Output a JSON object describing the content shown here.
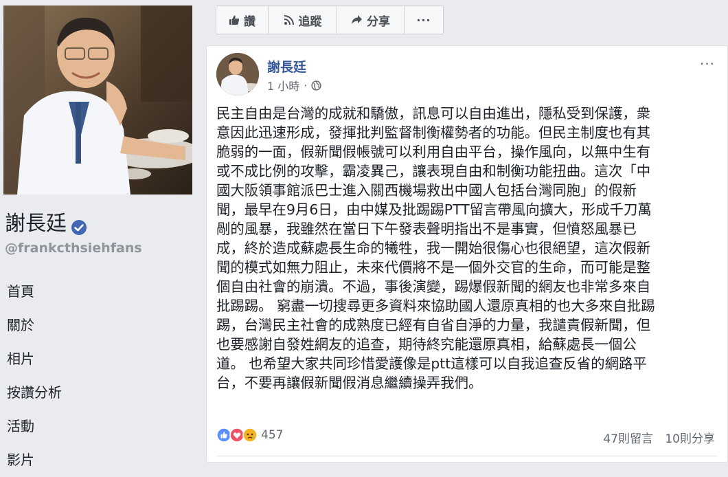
{
  "profile": {
    "name": "謝長廷",
    "handle": "@frankcthsiehfans",
    "verified": true
  },
  "nav": {
    "items": [
      {
        "label": "首頁"
      },
      {
        "label": "關於"
      },
      {
        "label": "相片"
      },
      {
        "label": "按讚分析"
      },
      {
        "label": "活動"
      },
      {
        "label": "影片"
      }
    ]
  },
  "actions": {
    "like_label": "讚",
    "follow_label": "追蹤",
    "share_label": "分享",
    "more_label": "···"
  },
  "post": {
    "author": "謝長廷",
    "time": "1 小時",
    "options_label": "···",
    "body": "民主自由是台灣的成就和驕傲，訊息可以自由進出，隱私受到保護，衆\n意因此迅速形成，發揮批判監督制衡權勢者的功能。但民主制度也有其\n脆弱的一面，假新聞假帳號可以利用自由平台，操作風向，以無中生有\n或不成比例的攻擊，霸凌異己，讓表現自由和制衡功能扭曲。這次「中\n國大阪領事館派巴士進入關西機場救出中國人包括台灣同胞」的假新\n聞，最早在9月6日，由中媒及批踢踢PTT留言帶風向擴大，形成千刀萬\n剮的風暴，我雖然在當日下午發表聲明指出不是事實，但憤怒風暴已\n成，終於造成蘇處長生命的犧牲，我一開始很傷心也很絕望，這次假新\n聞的模式如無力阻止，未來代價將不是一個外交官的生命，而可能是整\n個自由社會的崩潰。不過，事後演變，踢爆假新聞的網友也非常多來自\n批踢踢。 窮盡一切搜尋更多資料來協助國人還原真相的也大多來自批踢\n踢，台灣民主社會的成熟度已經有自省自淨的力量，我譴責假新聞，但\n也要感謝自發姓網友的追查，期待終究能還原真相，給蘇處長一個公\n道。 也希望大家共同珍惜愛護像是ptt這樣可以自我追查反省的網路平\n台，不要再讓假新聞假消息繼續操弄我們。",
    "reaction_count": "457",
    "comments": "47則留言",
    "shares": "10則分享"
  },
  "colors": {
    "link": "#365899",
    "verified": "#4267b2",
    "like": "#5890ff",
    "love": "#f25268",
    "sad": "#f7b125"
  },
  "icons": [
    "thumbs-up-icon",
    "rss-icon",
    "share-arrow-icon",
    "verified-icon",
    "globe-icon",
    "like-reaction-icon",
    "love-reaction-icon",
    "sad-reaction-icon"
  ]
}
